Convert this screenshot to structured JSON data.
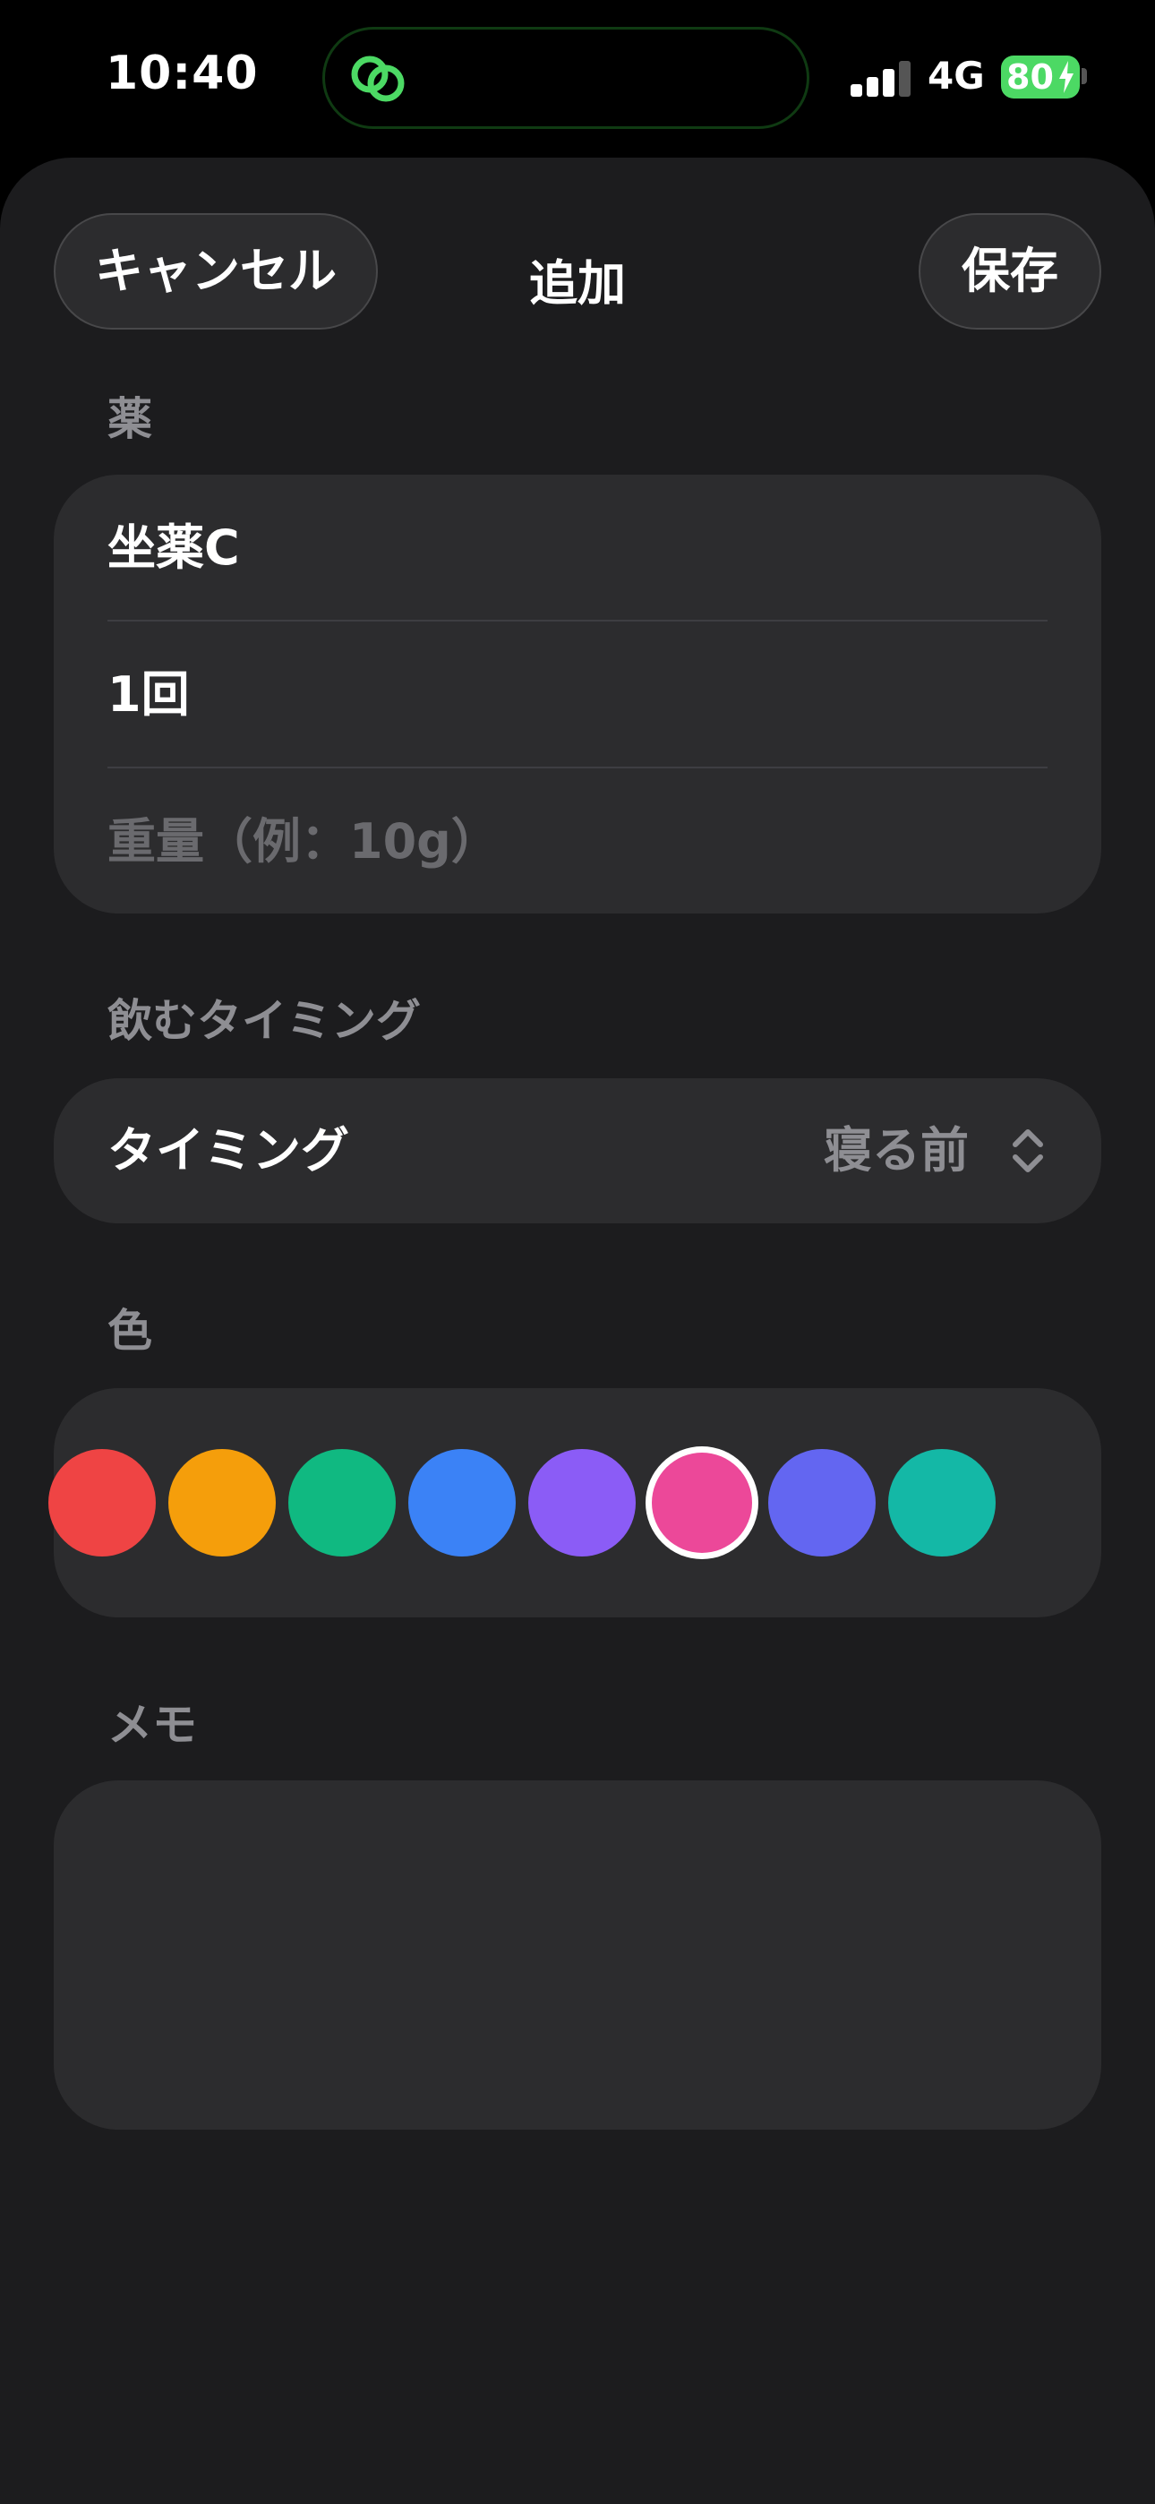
{
  "status_bar": {
    "time": "10:40",
    "network": "4G",
    "battery": "80",
    "island_icon": "link-rings-icon",
    "accent": "#4cd964"
  },
  "nav": {
    "cancel_label": "キャンセル",
    "title": "追加",
    "save_label": "保存"
  },
  "medicine_section": {
    "label": "薬",
    "name_value": "坐薬C",
    "dose_value": "1回",
    "weight_placeholder": "重量（例：10g）"
  },
  "timing_section": {
    "label": "飲むタイミング",
    "row_label": "タイミング",
    "selected_value": "寝る前",
    "icon": "chevron-up-down-icon"
  },
  "color_section": {
    "label": "色",
    "swatches": [
      "#ef4444",
      "#f59e0b",
      "#10b981",
      "#3b82f6",
      "#8b5cf6",
      "#ec4899",
      "#6366f1",
      "#14b8a6"
    ],
    "selected_color": "#ec4899"
  },
  "memo_section": {
    "label": "メモ",
    "value": ""
  }
}
